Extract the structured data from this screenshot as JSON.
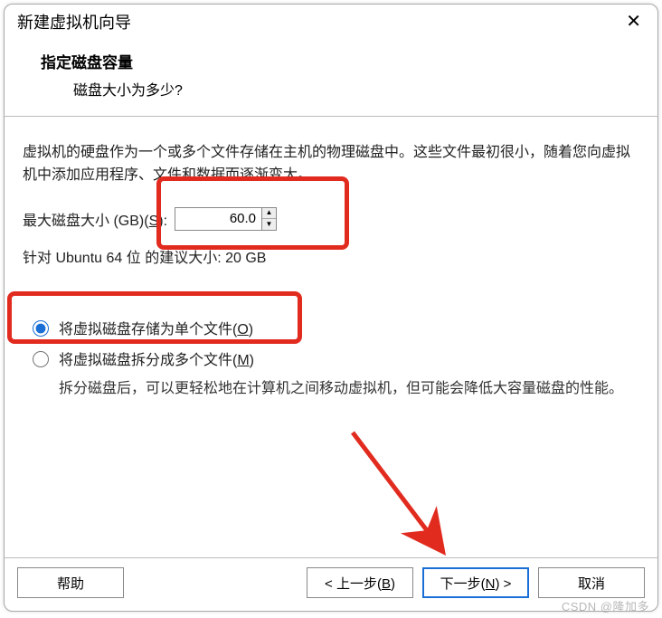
{
  "titlebar": {
    "title": "新建虚拟机向导"
  },
  "header": {
    "heading": "指定磁盘容量",
    "subheading": "磁盘大小为多少?"
  },
  "content": {
    "description": "虚拟机的硬盘作为一个或多个文件存储在主机的物理磁盘中。这些文件最初很小，随着您向虚拟机中添加应用程序、文件和数据而逐渐变大。",
    "size_label_prefix": "最大磁盘大小 (GB)(",
    "size_mnemonic": "S",
    "size_label_suffix": "):",
    "size_value": "60.0",
    "recommend_prefix": "针对 ",
    "recommend_os": "Ubuntu 64 位",
    "recommend_suffix": " 的建议大小: 20 GB",
    "radio_single_prefix": "将虚拟磁盘存储为单个文件(",
    "radio_single_mn": "O",
    "radio_single_suffix": ")",
    "radio_split_prefix": "将虚拟磁盘拆分成多个文件(",
    "radio_split_mn": "M",
    "radio_split_suffix": ")",
    "split_desc": "拆分磁盘后，可以更轻松地在计算机之间移动虚拟机，但可能会降低大容量磁盘的性能。"
  },
  "footer": {
    "help": "帮助",
    "back_prefix": "< 上一步(",
    "back_mn": "B",
    "back_suffix": ")",
    "next_prefix": "下一步(",
    "next_mn": "N",
    "next_suffix": ") >",
    "cancel": "取消"
  },
  "watermark": "CSDN @隆加多"
}
